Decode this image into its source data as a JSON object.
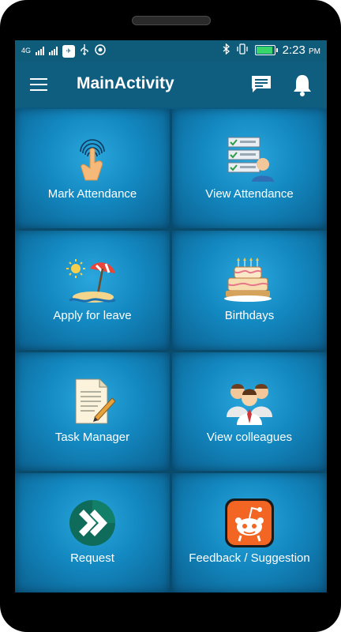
{
  "status_bar": {
    "network": "4G",
    "time": "2:23",
    "ampm": "PM",
    "battery_level_pct": 95,
    "icons": [
      "signal-icon",
      "app-notification-icon",
      "usb-icon",
      "whatsapp-icon",
      "bluetooth-icon",
      "vibrate-icon",
      "battery-icon"
    ]
  },
  "app_bar": {
    "title": "MainActivity",
    "icons": [
      "menu-icon",
      "chat-icon",
      "bell-icon"
    ]
  },
  "tiles": [
    {
      "label": "Mark Attendance",
      "icon": "fingerprint-touch-icon"
    },
    {
      "label": "View Attendance",
      "icon": "checklist-user-icon"
    },
    {
      "label": "Apply for leave",
      "icon": "beach-umbrella-icon"
    },
    {
      "label": "Birthdays",
      "icon": "birthday-cake-icon"
    },
    {
      "label": "Task Manager",
      "icon": "document-pen-icon"
    },
    {
      "label": "View colleagues",
      "icon": "colleagues-group-icon"
    },
    {
      "label": "Request",
      "icon": "forward-arrow-icon"
    },
    {
      "label": "Feedback / Suggestion",
      "icon": "feedback-robot-icon"
    }
  ],
  "colors": {
    "app_bar": "#0f5e80",
    "tile_center": "#2aa7dd",
    "tile_edge": "#0b5f8e",
    "request_badge": "#0f6b5a",
    "feedback_badge": "#f26522"
  }
}
